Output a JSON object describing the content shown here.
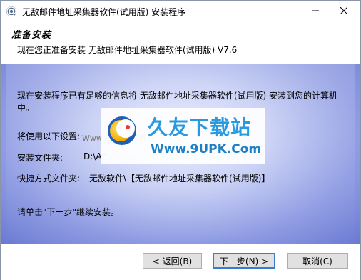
{
  "window": {
    "title": "无敌邮件地址采集器软件(试用版) 安装程序"
  },
  "header": {
    "title": "准备安装",
    "subtitle": "现在您正准备安装 无敌邮件地址采集器软件(试用版) V7.6"
  },
  "body": {
    "intro_line1": "现在安装程序已有足够的信息将 无敌邮件地址采集器软件(试用版) 安装到您的计算机",
    "intro_line2": "中。",
    "settings_label": "将使用以下设置:",
    "install_folder_label": "安装文件夹:",
    "install_folder_value": "D:\\Ar",
    "shortcut_label": "快捷方式文件夹:",
    "shortcut_value": "无敌软件\\【无敌邮件地址采集器软件(试用版)】",
    "continue_text": "请单击\"下一步\"继续安装。"
  },
  "watermark": {
    "brand": "久友下载站",
    "url": "Www.9UPK.Com",
    "side_text": "Www.9UPK.COM"
  },
  "footer": {
    "back_label": "< 返回(B)",
    "next_label": "下一步(N) >",
    "cancel_label": "取消(C)"
  },
  "colors": {
    "accent": "#3a7bd5",
    "body_gradient_edge": "#6a7ad2",
    "watermark_blue": "#2a9ae0"
  },
  "icons": {
    "app": "mail-at-icon",
    "minimize": "minimize-icon",
    "close": "close-icon",
    "logo": "moon-logo-icon"
  }
}
